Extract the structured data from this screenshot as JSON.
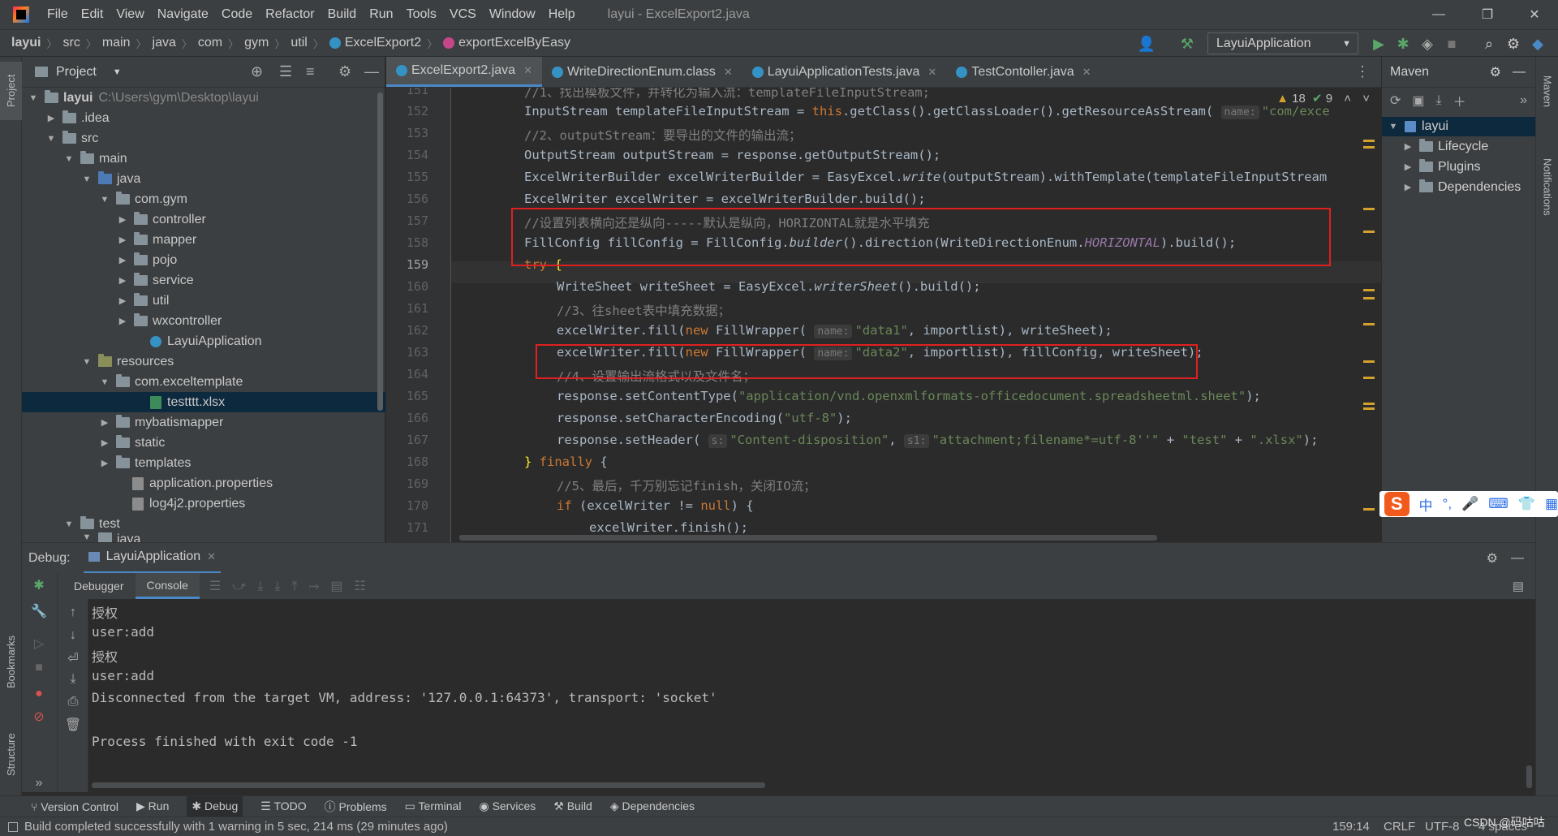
{
  "window": {
    "menu": [
      "File",
      "Edit",
      "View",
      "Navigate",
      "Code",
      "Refactor",
      "Build",
      "Run",
      "Tools",
      "VCS",
      "Window",
      "Help"
    ],
    "title": "layui - ExcelExport2.java",
    "controls": [
      "—",
      "❐",
      "✕"
    ]
  },
  "breadcrumb": [
    "layui",
    "src",
    "main",
    "java",
    "com",
    "gym",
    "util",
    "ExcelExport2",
    "exportExcelByEasy"
  ],
  "run_config": "LayuiApplication",
  "left_stripe": {
    "project": "Project",
    "bookmarks": "Bookmarks",
    "structure": "Structure"
  },
  "right_stripe": {
    "maven": "Maven",
    "notifications": "Notifications"
  },
  "project_panel": {
    "title": "Project",
    "tree": [
      {
        "label": "layui",
        "extra": "C:\\Users\\gym\\Desktop\\layui"
      },
      {
        "label": ".idea"
      },
      {
        "label": "src"
      },
      {
        "label": "main"
      },
      {
        "label": "java"
      },
      {
        "label": "com.gym"
      },
      {
        "label": "controller"
      },
      {
        "label": "mapper"
      },
      {
        "label": "pojo"
      },
      {
        "label": "service"
      },
      {
        "label": "util"
      },
      {
        "label": "wxcontroller"
      },
      {
        "label": "LayuiApplication"
      },
      {
        "label": "resources"
      },
      {
        "label": "com.exceltemplate"
      },
      {
        "label": "testttt.xlsx"
      },
      {
        "label": "mybatismapper"
      },
      {
        "label": "static"
      },
      {
        "label": "templates"
      },
      {
        "label": "application.properties"
      },
      {
        "label": "log4j2.properties"
      },
      {
        "label": "test"
      },
      {
        "label": "java"
      }
    ]
  },
  "editor_tabs": [
    "ExcelExport2.java",
    "WriteDirectionEnum.class",
    "LayuiApplicationTests.java",
    "TestContoller.java"
  ],
  "editor": {
    "warnings": "18",
    "weak_warnings": "9",
    "line_numbers": [
      "151",
      "152",
      "153",
      "154",
      "155",
      "156",
      "157",
      "158",
      "159",
      "160",
      "161",
      "162",
      "163",
      "164",
      "165",
      "166",
      "167",
      "168",
      "169",
      "170",
      "171"
    ],
    "current_line": "159",
    "code": {
      "l151": "//1、找出模板文件，并转化为输入流：templateFileInputStream;",
      "l152a": "InputStream templateFileInputStream = ",
      "l152b": "this",
      "l152c": ".getClass().getClassLoader().getResourceAsStream(",
      "l152hint": "name:",
      "l152d": "\"com/exce",
      "l153": "//2、outputStream：要导出的文件的输出流；",
      "l154": "OutputStream outputStream = response.getOutputStream();",
      "l155a": "ExcelWriterBuilder excelWriterBuilder = EasyExcel.",
      "l155b": "write",
      "l155c": "(outputStream).withTemplate(templateFileInputStream",
      "l156": "ExcelWriter excelWriter = excelWriterBuilder.build();",
      "l157": "//设置列表横向还是纵向-----默认是纵向，HORIZONTAL就是水平填充",
      "l158a": "FillConfig fillConfig = FillConfig.",
      "l158b": "builder",
      "l158c": "().direction(WriteDirectionEnum.",
      "l158d": "HORIZONTAL",
      "l158e": ").build();",
      "l159a": "try",
      "l159b": " {",
      "l160a": "WriteSheet writeSheet = EasyExcel.",
      "l160b": "writerSheet",
      "l160c": "().build();",
      "l161": "//3、往sheet表中填充数据；",
      "l162a": "excelWriter.fill(",
      "l162b": "new",
      "l162c": " FillWrapper(",
      "l162hint": "name:",
      "l162d": "\"data1\"",
      "l162e": ", importlist), writeSheet);",
      "l163a": "excelWriter.fill(",
      "l163b": "new",
      "l163c": " FillWrapper(",
      "l163hint": "name:",
      "l163d": "\"data2\"",
      "l163e": ", importlist), fillConfig, writeSheet);",
      "l164": "//4、设置输出流格式以及文件名；",
      "l165a": "response.setContentType(",
      "l165b": "\"application/vnd.openxmlformats-officedocument.spreadsheetml.sheet\"",
      "l165c": ");",
      "l166a": "response.setCharacterEncoding(",
      "l166b": "\"utf-8\"",
      "l166c": ");",
      "l167a": "response.setHeader(",
      "l167hint1": "s:",
      "l167b": "\"Content-disposition\"",
      "l167c": ", ",
      "l167hint2": "s1:",
      "l167d": "\"attachment;filename*=utf-8''\"",
      "l167e": " + ",
      "l167f": "\"test\"",
      "l167g": " + ",
      "l167h": "\".xlsx\"",
      "l167i": ");",
      "l168a": "} ",
      "l168b": "finally",
      "l168c": " {",
      "l169": "//5、最后，千万别忘记finish，关闭IO流；",
      "l170a": "if",
      "l170b": " (excelWriter != ",
      "l170c": "null",
      "l170d": ") {",
      "l171": "excelWriter.finish();"
    }
  },
  "maven": {
    "title": "Maven",
    "tree": [
      "layui",
      "Lifecycle",
      "Plugins",
      "Dependencies"
    ]
  },
  "ime": {
    "logo": "S",
    "lang": "中"
  },
  "debug": {
    "label": "Debug:",
    "session": "LayuiApplication",
    "tabs": [
      "Debugger",
      "Console"
    ],
    "console_lines": [
      "授权",
      "user:add",
      "授权",
      "user:add",
      "Disconnected from the target VM, address: '127.0.0.1:64373', transport: 'socket'",
      "",
      "Process finished with exit code -1"
    ]
  },
  "tool_tabs": [
    "Version Control",
    "Run",
    "Debug",
    "TODO",
    "Problems",
    "Terminal",
    "Services",
    "Build",
    "Dependencies"
  ],
  "status": {
    "message": "Build completed successfully with 1 warning in 5 sec, 214 ms (29 minutes ago)",
    "position": "159:14",
    "line_sep": "CRLF",
    "encoding": "UTF-8",
    "indent": "4 spaces",
    "watermark": "CSDN @码咕咕"
  },
  "colors": {
    "accent": "#4a88c7",
    "highlight_box": "#e02020",
    "selection": "#0d293e",
    "keyword": "#cc7832",
    "string": "#6a8759"
  }
}
